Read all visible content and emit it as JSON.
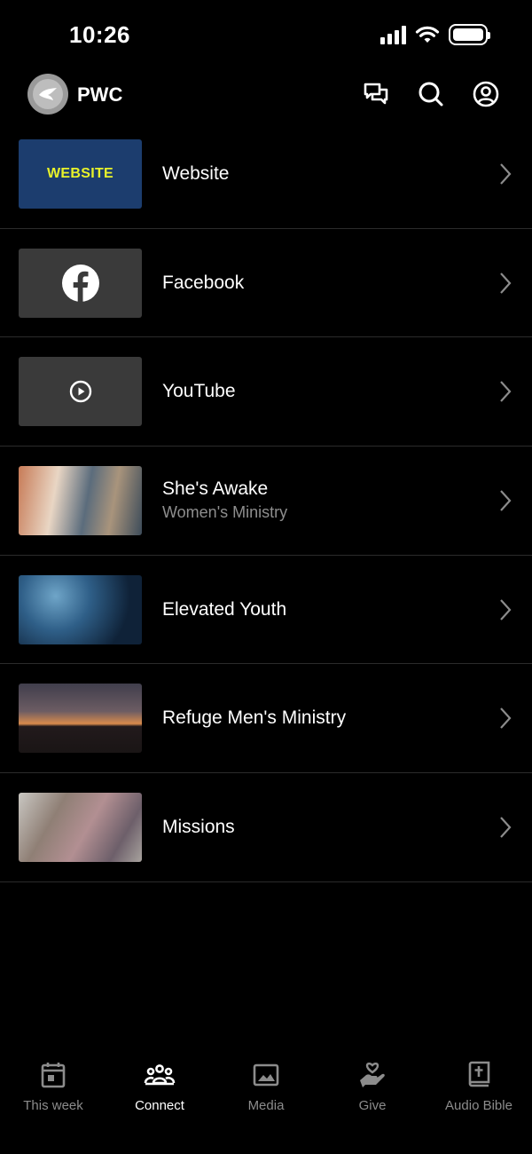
{
  "status": {
    "time": "10:26"
  },
  "header": {
    "brand": "PWC"
  },
  "list": [
    {
      "title": "Website",
      "subtitle": "",
      "thumb_text": "WEBSITE",
      "thumb": "website-banner"
    },
    {
      "title": "Facebook",
      "subtitle": "",
      "thumb": "facebook-icon"
    },
    {
      "title": "YouTube",
      "subtitle": "",
      "thumb": "play-icon"
    },
    {
      "title": "She's Awake",
      "subtitle": "Women's Ministry",
      "thumb": "photo-women"
    },
    {
      "title": "Elevated Youth",
      "subtitle": "",
      "thumb": "photo-youth"
    },
    {
      "title": "Refuge Men's Ministry",
      "subtitle": "",
      "thumb": "photo-men"
    },
    {
      "title": "Missions",
      "subtitle": "",
      "thumb": "photo-missions"
    }
  ],
  "tabs": [
    {
      "label": "This week",
      "icon": "calendar-icon",
      "active": false
    },
    {
      "label": "Connect",
      "icon": "group-icon",
      "active": true
    },
    {
      "label": "Media",
      "icon": "image-icon",
      "active": false
    },
    {
      "label": "Give",
      "icon": "give-hand-heart-icon",
      "active": false
    },
    {
      "label": "Audio Bible",
      "icon": "bible-icon",
      "active": false
    }
  ],
  "colors": {
    "background": "#000000",
    "accent": "#ffffff",
    "muted": "#8c8c8c",
    "website_text": "#e8f22a"
  }
}
